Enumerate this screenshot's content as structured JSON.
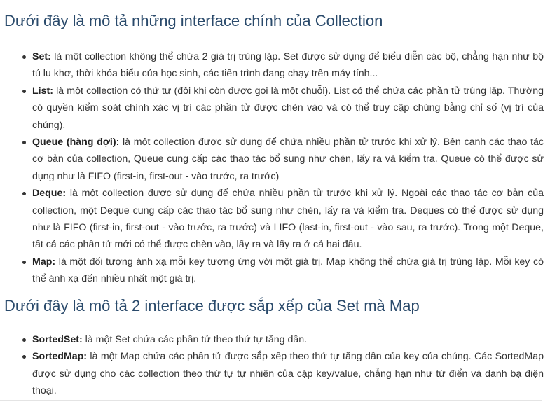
{
  "section1": {
    "heading": "Dưới đây là mô tả những interface chính của Collection",
    "items": [
      {
        "term": "Set:",
        "text": " là một collection không thể chứa 2 giá trị trùng lặp. Set được sử dụng để biểu diễn các bộ, chẳng hạn như bộ tú lu khơ, thời khóa biểu của học sinh, các tiến trình đang chạy trên máy tính..."
      },
      {
        "term": "List:",
        "text": " là một collection có thứ tự (đôi khi còn được gọi là một chuỗi). List có thể chứa các phần tử trùng lặp. Thường có quyền kiểm soát chính xác vị trí các phần tử được chèn vào và có thể truy cập chúng bằng chỉ số (vị trí của chúng)."
      },
      {
        "term": "Queue (hàng đợi):",
        "text": " là một collection được sử dụng để chứa nhiều phần tử trước khi xử lý. Bên cạnh các thao tác cơ bản của collection, Queue cung cấp các thao tác bổ sung như chèn, lấy ra và kiểm tra. Queue có thể được sử dụng như là FIFO (first-in, first-out - vào trước, ra trước)"
      },
      {
        "term": "Deque:",
        "text": " là một collection được sử dụng để chứa nhiều phần tử trước khi xử lý. Ngoài các thao tác cơ bản của collection, một Deque cung cấp các thao tác bổ sung như chèn, lấy ra và kiểm tra. Deques có thể được sử dụng như là FIFO (first-in, first-out - vào trước, ra trước) và LIFO (last-in, first-out - vào sau, ra trước). Trong một Deque, tất cả các phần tử mới có thể được chèn vào, lấy ra và lấy ra ở cả hai đầu."
      },
      {
        "term": "Map:",
        "text": " là một đối tượng ánh xạ mỗi key tương ứng với một giá trị. Map không thể chứa giá trị trùng lặp. Mỗi key có thể ánh xạ đến nhiều nhất một giá trị."
      }
    ]
  },
  "section2": {
    "heading": "Dưới đây là mô tả 2 interface được sắp xếp của Set mà Map",
    "items": [
      {
        "term": "SortedSet:",
        "text": " là một Set chứa các phần tử theo thứ tự tăng dần."
      },
      {
        "term": "SortedMap:",
        "text": " là một Map chứa các phần tử được sắp xếp theo thứ tự tăng dần của key của chúng. Các SortedMap được sử dụng cho các collection theo thứ tự tự nhiên của cặp key/value, chẳng hạn như từ điển và danh bạ điện thoại."
      }
    ]
  }
}
